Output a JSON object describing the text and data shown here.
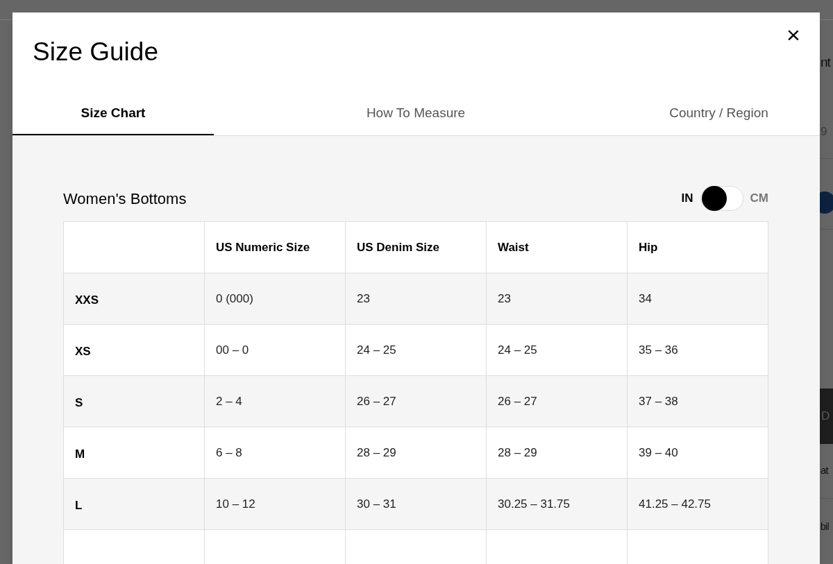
{
  "backdrop": {
    "fragments": [
      "nt",
      "9",
      "D",
      "at",
      "bil"
    ]
  },
  "dialog": {
    "title": "Size Guide",
    "close": "×"
  },
  "tabs": [
    {
      "label": "Size Chart",
      "selected": true
    },
    {
      "label": "How To Measure",
      "selected": false
    },
    {
      "label": "Country / Region",
      "selected": false
    }
  ],
  "section": {
    "title": "Women's Bottoms",
    "unit_toggle": [
      {
        "label": "IN",
        "selected": true
      },
      {
        "label": "CM",
        "selected": false
      }
    ],
    "table": {
      "columns": [
        "US Numeric Size",
        "US Denim Size",
        "Waist",
        "Hip"
      ],
      "rows": [
        {
          "size": "XXS",
          "cells": [
            "0 (000)",
            "23",
            "23",
            "34"
          ]
        },
        {
          "size": "XS",
          "cells": [
            "00 – 0",
            "24 – 25",
            "24 – 25",
            "35 – 36"
          ]
        },
        {
          "size": "S",
          "cells": [
            "2 – 4",
            "26 – 27",
            "26 – 27",
            "37 – 38"
          ]
        },
        {
          "size": "M",
          "cells": [
            "6 – 8",
            "28 – 29",
            "28 – 29",
            "39 – 40"
          ]
        },
        {
          "size": "L",
          "cells": [
            "10 – 12",
            "30 – 31",
            "30.25 – 31.75",
            "41.25 – 42.75"
          ]
        }
      ]
    }
  }
}
